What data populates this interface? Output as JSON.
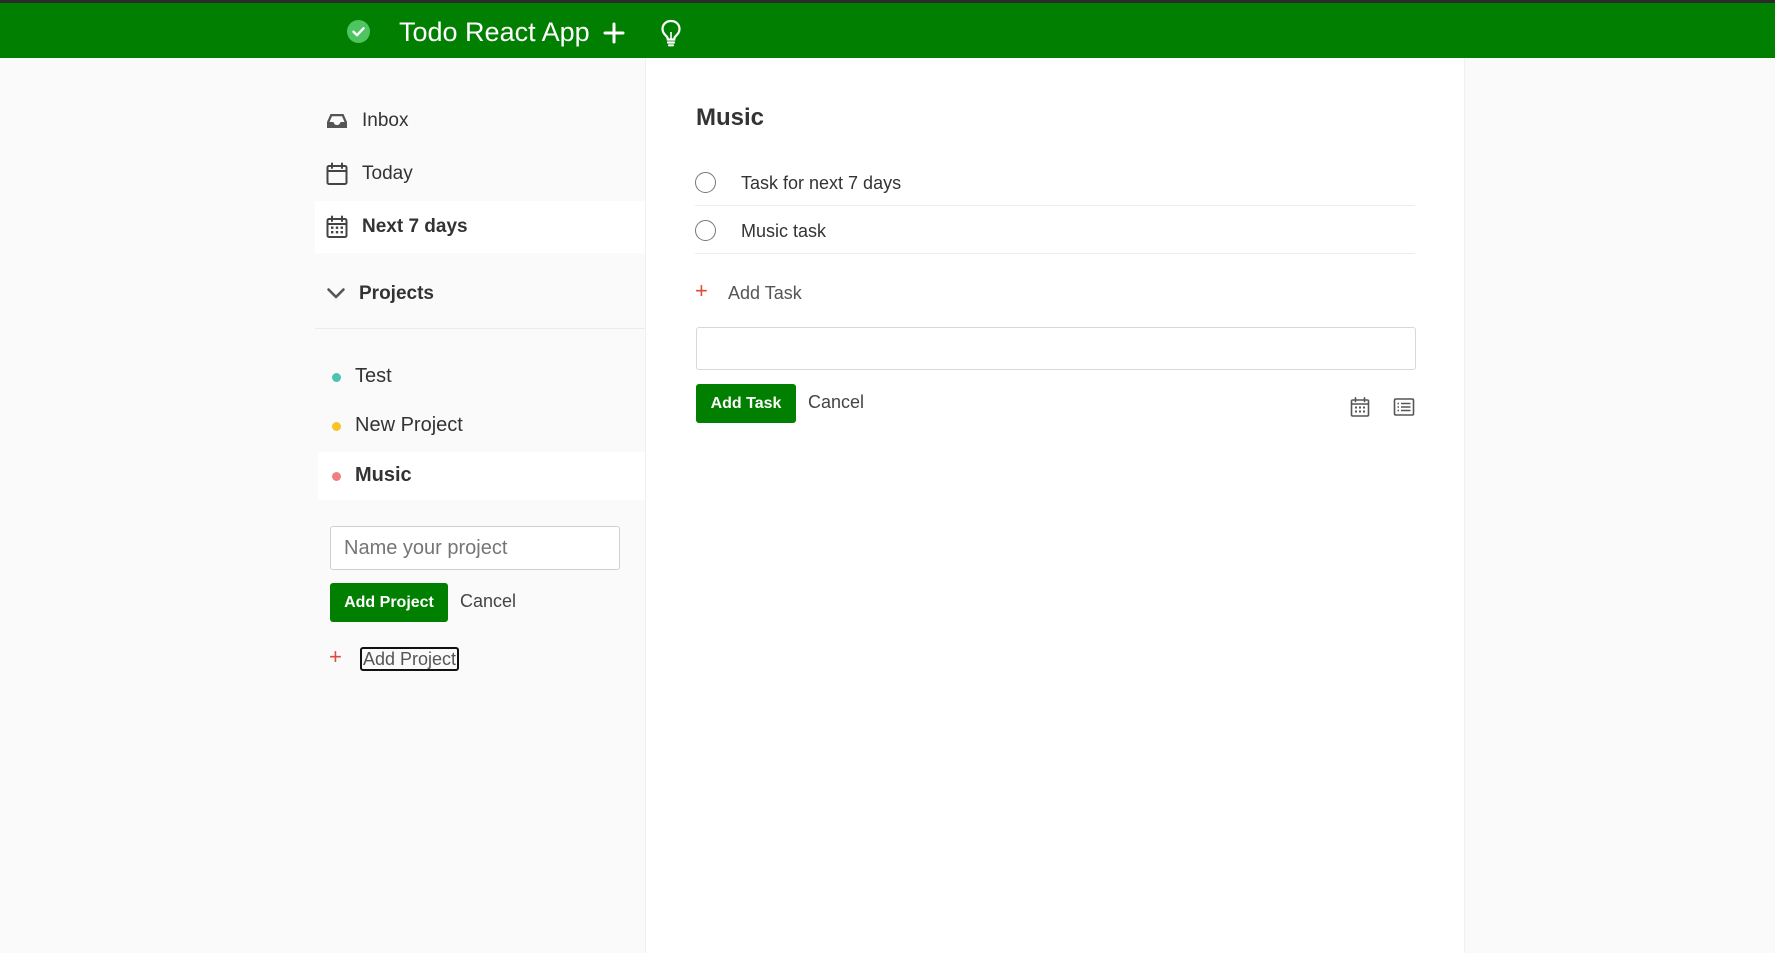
{
  "header": {
    "logo_icon": "check-circle-icon",
    "title": "Todo React App",
    "quick_add_icon": "plus-icon",
    "theme_icon": "lightbulb-icon",
    "color": "#017f01"
  },
  "sidebar": {
    "nav": [
      {
        "label": "Inbox",
        "icon": "inbox-icon"
      },
      {
        "label": "Today",
        "icon": "calendar-icon"
      },
      {
        "label": "Next 7 days",
        "icon": "calendar-dates-icon",
        "active": true
      }
    ],
    "projects_header": "Projects",
    "projects": [
      {
        "name": "Test",
        "color": "#48c4b0"
      },
      {
        "name": "New Project",
        "color": "#f7c325"
      },
      {
        "name": "Music",
        "color": "#f08080",
        "active": true
      }
    ],
    "add_project_form": {
      "placeholder": "Name your project",
      "submit_label": "Add Project",
      "cancel_label": "Cancel"
    },
    "add_project_link": "Add Project"
  },
  "main": {
    "title": "Music",
    "tasks": [
      {
        "label": "Task for next 7 days"
      },
      {
        "label": "Music task"
      }
    ],
    "add_task_label": "Add Task",
    "add_task_form": {
      "submit_label": "Add Task",
      "cancel_label": "Cancel",
      "date_icon": "calendar-icon",
      "project_icon": "list-icon"
    }
  },
  "colors": {
    "accent_green": "#017f01",
    "plus_red": "#dd4b39"
  }
}
